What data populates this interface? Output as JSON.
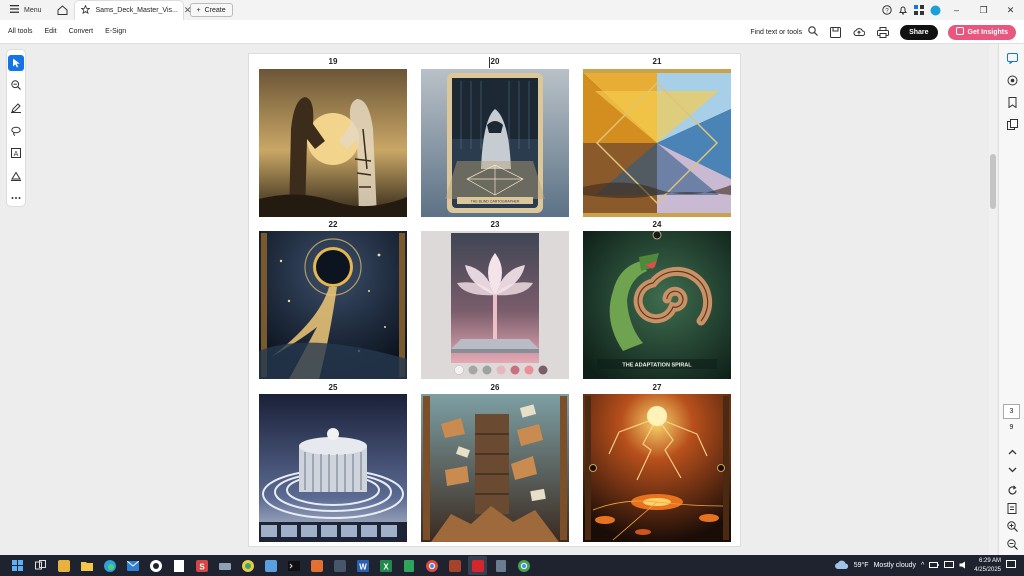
{
  "titlebar": {
    "menu_label": "Menu",
    "tab_title": "Sams_Deck_Master_Vis...",
    "create_label": "Create"
  },
  "toolbar": {
    "items": [
      "All tools",
      "Edit",
      "Convert",
      "E-Sign"
    ],
    "find_text": "Find text or tools",
    "share_label": "Share",
    "insights_label": "Get Insights"
  },
  "document": {
    "cards": [
      {
        "num": "19",
        "icon": "handshake-skeleton-card",
        "palette": [
          "#5a4128",
          "#e9c77b",
          "#2e2417"
        ]
      },
      {
        "num": "20",
        "icon": "hooded-figure-card",
        "palette": [
          "#c8ccd0",
          "#5c7286",
          "#1c2833"
        ]
      },
      {
        "num": "21",
        "icon": "prism-card",
        "palette": [
          "#e0a72c",
          "#1c3f6d",
          "#a9cfe8"
        ]
      },
      {
        "num": "22",
        "icon": "eclipse-card",
        "palette": [
          "#1d2a3a",
          "#e3b04b",
          "#0c1420"
        ]
      },
      {
        "num": "23",
        "icon": "lotus-card",
        "palette": [
          "#d8d5d6",
          "#f3c3cf",
          "#555566"
        ]
      },
      {
        "num": "24",
        "icon": "serpent-spiral-card",
        "palette": [
          "#1e3b2e",
          "#7cae5a",
          "#c88c5c"
        ]
      },
      {
        "num": "25",
        "icon": "spiral-tower-card",
        "palette": [
          "#1c2440",
          "#d0d4dc",
          "#7a86a6"
        ]
      },
      {
        "num": "26",
        "icon": "flying-books-card",
        "palette": [
          "#3b2a20",
          "#7d9fa3",
          "#c98b50"
        ]
      },
      {
        "num": "27",
        "icon": "volcanic-lightning-card",
        "palette": [
          "#1a0d08",
          "#e8731f",
          "#f8d26a"
        ]
      }
    ],
    "card23_caption": "",
    "card24_caption": "THE ADAPTATION SPIRAL",
    "card20_caption": "THE BLIND CARTOGRAPHER"
  },
  "rail": {
    "current_page": "3",
    "total_pages": "9"
  },
  "taskbar": {
    "weather": "59°F",
    "weather_desc": "Mostly cloudy",
    "time": "6:29 AM",
    "date": "4/25/2025"
  }
}
